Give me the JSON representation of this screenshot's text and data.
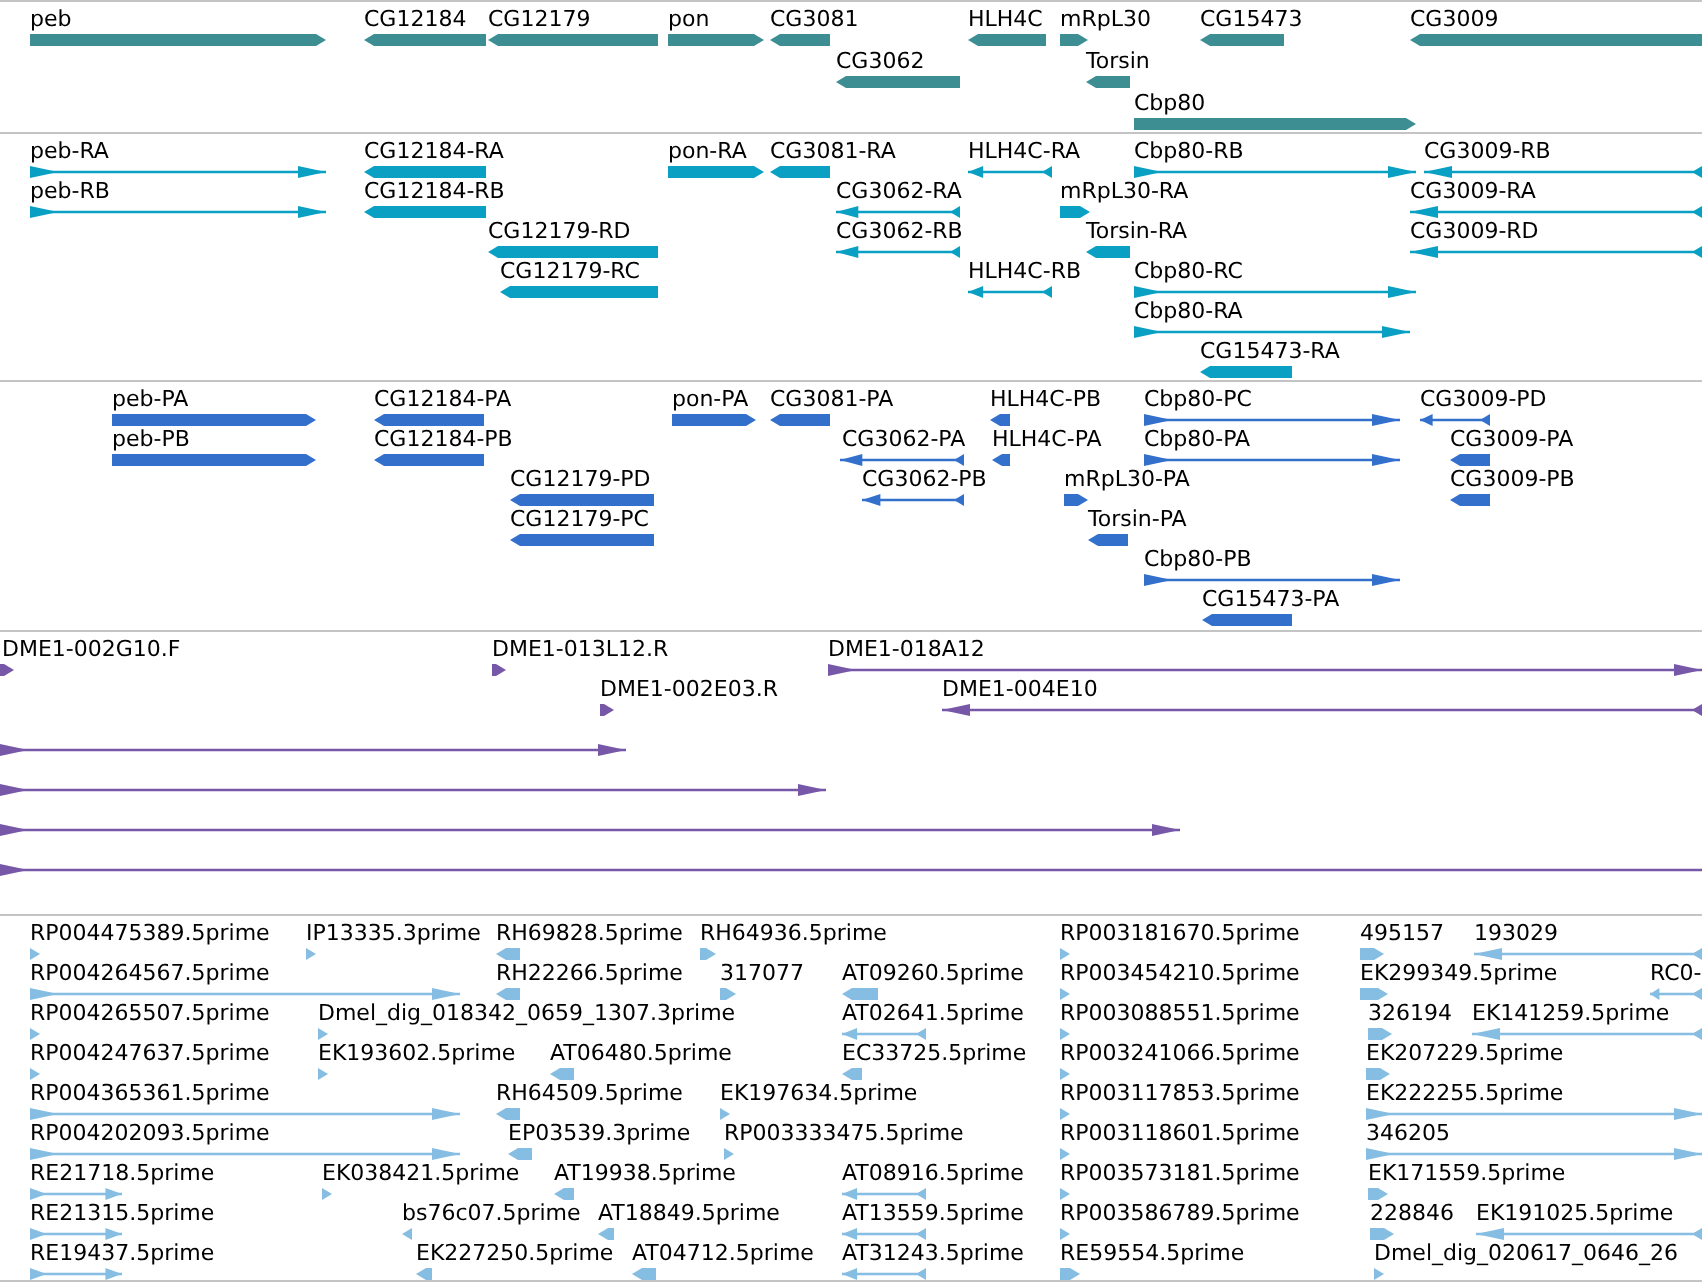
{
  "tracks": [
    {
      "kind": "gene",
      "rows": [
        {
          "features": [
            {
              "label": "peb",
              "forward": true,
              "kind": "block"
            },
            {
              "label": "CG12184",
              "forward": false,
              "kind": "block"
            },
            {
              "label": "CG12179",
              "forward": false,
              "kind": "block"
            },
            {
              "label": "pon",
              "forward": true,
              "kind": "block"
            },
            {
              "label": "CG3081",
              "forward": false,
              "kind": "block"
            },
            {
              "label": "HLH4C",
              "forward": false,
              "kind": "block"
            },
            {
              "label": "mRpL30",
              "forward": true,
              "kind": "block"
            },
            {
              "label": "CG15473",
              "forward": false,
              "kind": "block"
            },
            {
              "label": "CG3009",
              "forward": false,
              "kind": "block"
            }
          ]
        },
        {
          "features": [
            {
              "label": "CG3062",
              "forward": false,
              "kind": "block"
            },
            {
              "label": "Torsin",
              "forward": false,
              "kind": "block"
            }
          ]
        },
        {
          "features": [
            {
              "label": "Cbp80",
              "forward": true,
              "kind": "block"
            }
          ]
        }
      ]
    },
    {
      "kind": "transcript",
      "rows": [
        {
          "features": [
            {
              "label": "peb-RA",
              "forward": true,
              "kind": "spliced"
            },
            {
              "label": "CG12184-RA",
              "forward": false,
              "kind": "block"
            },
            {
              "label": "pon-RA",
              "forward": true,
              "kind": "block"
            },
            {
              "label": "CG3081-RA",
              "forward": false,
              "kind": "block"
            },
            {
              "label": "HLH4C-RA",
              "forward": false,
              "kind": "spliced"
            },
            {
              "label": "Cbp80-RB",
              "forward": true,
              "kind": "spliced"
            },
            {
              "label": "CG3009-RB",
              "forward": false,
              "kind": "spliced"
            }
          ]
        },
        {
          "features": [
            {
              "label": "peb-RB",
              "forward": true,
              "kind": "spliced"
            },
            {
              "label": "CG12184-RB",
              "forward": false,
              "kind": "block"
            },
            {
              "label": "CG3062-RA",
              "forward": false,
              "kind": "spliced"
            },
            {
              "label": "mRpL30-RA",
              "forward": true,
              "kind": "block"
            },
            {
              "label": "CG3009-RA",
              "forward": false,
              "kind": "spliced"
            }
          ]
        },
        {
          "features": [
            {
              "label": "CG12179-RD",
              "forward": false,
              "kind": "block"
            },
            {
              "label": "CG3062-RB",
              "forward": false,
              "kind": "spliced"
            },
            {
              "label": "Torsin-RA",
              "forward": false,
              "kind": "block"
            },
            {
              "label": "CG3009-RD",
              "forward": false,
              "kind": "spliced"
            }
          ]
        },
        {
          "features": [
            {
              "label": "CG12179-RC",
              "forward": false,
              "kind": "block"
            },
            {
              "label": "HLH4C-RB",
              "forward": false,
              "kind": "spliced"
            },
            {
              "label": "Cbp80-RC",
              "forward": true,
              "kind": "spliced"
            }
          ]
        },
        {
          "features": [
            {
              "label": "Cbp80-RA",
              "forward": true,
              "kind": "spliced"
            }
          ]
        },
        {
          "features": [
            {
              "label": "CG15473-RA",
              "forward": false,
              "kind": "block"
            }
          ]
        }
      ]
    },
    {
      "kind": "protein",
      "rows": [
        {
          "features": [
            {
              "label": "peb-PA",
              "forward": true,
              "kind": "block"
            },
            {
              "label": "CG12184-PA",
              "forward": false,
              "kind": "block"
            },
            {
              "label": "pon-PA",
              "forward": true,
              "kind": "block"
            },
            {
              "label": "CG3081-PA",
              "forward": false,
              "kind": "block"
            },
            {
              "label": "HLH4C-PB",
              "forward": false,
              "kind": "block"
            },
            {
              "label": "Cbp80-PC",
              "forward": true,
              "kind": "spliced"
            },
            {
              "label": "CG3009-PD",
              "forward": false,
              "kind": "spliced"
            }
          ]
        },
        {
          "features": [
            {
              "label": "peb-PB",
              "forward": true,
              "kind": "block"
            },
            {
              "label": "CG12184-PB",
              "forward": false,
              "kind": "block"
            },
            {
              "label": "CG3062-PA",
              "forward": false,
              "kind": "spliced"
            },
            {
              "label": "HLH4C-PA",
              "forward": false,
              "kind": "block"
            },
            {
              "label": "Cbp80-PA",
              "forward": true,
              "kind": "spliced"
            },
            {
              "label": "CG3009-PA",
              "forward": false,
              "kind": "block"
            }
          ]
        },
        {
          "features": [
            {
              "label": "CG12179-PD",
              "forward": false,
              "kind": "block"
            },
            {
              "label": "CG3062-PB",
              "forward": false,
              "kind": "spliced"
            },
            {
              "label": "mRpL30-PA",
              "forward": true,
              "kind": "block"
            },
            {
              "label": "CG3009-PB",
              "forward": false,
              "kind": "block"
            }
          ]
        },
        {
          "features": [
            {
              "label": "CG12179-PC",
              "forward": false,
              "kind": "block"
            },
            {
              "label": "Torsin-PA",
              "forward": false,
              "kind": "block"
            }
          ]
        },
        {
          "features": [
            {
              "label": "Cbp80-PB",
              "forward": true,
              "kind": "spliced"
            }
          ]
        },
        {
          "features": [
            {
              "label": "CG15473-PA",
              "forward": false,
              "kind": "block"
            }
          ]
        }
      ]
    },
    {
      "kind": "clone",
      "rows": [
        {
          "features": [
            {
              "label": "DME1-002G10.F",
              "forward": true,
              "kind": "block"
            },
            {
              "label": "DME1-013L12.R",
              "forward": true,
              "kind": "block"
            },
            {
              "label": "DME1-018A12",
              "forward": true,
              "kind": "spliced"
            }
          ]
        },
        {
          "features": [
            {
              "label": "DME1-002E03.R",
              "forward": true,
              "kind": "block"
            },
            {
              "label": "DME1-004E10",
              "forward": false,
              "kind": "spliced"
            }
          ]
        },
        {
          "features": [
            {
              "forward": true,
              "kind": "spliced"
            }
          ]
        },
        {
          "features": [
            {
              "forward": true,
              "kind": "spliced"
            }
          ]
        },
        {
          "features": [
            {
              "forward": true,
              "kind": "spliced"
            }
          ]
        },
        {
          "features": [
            {
              "forward": true,
              "kind": "spliced"
            }
          ]
        }
      ]
    },
    {
      "kind": "est",
      "rows": [
        {
          "features": [
            {
              "label": "RP004475389.5prime",
              "forward": true,
              "kind": "block"
            },
            {
              "label": "IP13335.3prime",
              "forward": true,
              "kind": "block"
            },
            {
              "label": "RH69828.5prime",
              "forward": false,
              "kind": "block"
            },
            {
              "label": "RH64936.5prime",
              "forward": true,
              "kind": "block"
            },
            {
              "label": "RP003181670.5prime",
              "forward": true,
              "kind": "block"
            },
            {
              "label": "495157",
              "forward": true,
              "kind": "block"
            },
            {
              "label": "193029",
              "forward": false,
              "kind": "spliced"
            }
          ]
        },
        {
          "features": [
            {
              "label": "RP004264567.5prime",
              "forward": true,
              "kind": "spliced"
            },
            {
              "label": "RH22266.5prime",
              "forward": false,
              "kind": "block"
            },
            {
              "label": "317077",
              "forward": true,
              "kind": "block"
            },
            {
              "label": "AT09260.5prime",
              "forward": false,
              "kind": "block"
            },
            {
              "label": "RP003454210.5prime",
              "forward": true,
              "kind": "block"
            },
            {
              "label": "EK299349.5prime",
              "forward": true,
              "kind": "block"
            },
            {
              "label": "RC0-",
              "forward": false,
              "kind": "spliced"
            }
          ]
        },
        {
          "features": [
            {
              "label": "RP004265507.5prime",
              "forward": true,
              "kind": "block"
            },
            {
              "label": "Dmel_dig_018342_0659_1307.3prime",
              "forward": true,
              "kind": "block"
            },
            {
              "label": "AT02641.5prime",
              "forward": false,
              "kind": "spliced"
            },
            {
              "label": "RP003088551.5prime",
              "forward": true,
              "kind": "block"
            },
            {
              "label": "326194",
              "forward": true,
              "kind": "block"
            },
            {
              "label": "EK141259.5prime",
              "forward": false,
              "kind": "spliced"
            }
          ]
        },
        {
          "features": [
            {
              "label": "RP004247637.5prime",
              "forward": true,
              "kind": "block"
            },
            {
              "label": "EK193602.5prime",
              "forward": true,
              "kind": "block"
            },
            {
              "label": "AT06480.5prime",
              "forward": false,
              "kind": "block"
            },
            {
              "label": "EC33725.5prime",
              "forward": false,
              "kind": "block"
            },
            {
              "label": "RP003241066.5prime",
              "forward": true,
              "kind": "block"
            },
            {
              "label": "EK207229.5prime",
              "forward": true,
              "kind": "block"
            }
          ]
        },
        {
          "features": [
            {
              "label": "RP004365361.5prime",
              "forward": true,
              "kind": "spliced"
            },
            {
              "label": "RH64509.5prime",
              "forward": false,
              "kind": "block"
            },
            {
              "label": "EK197634.5prime",
              "forward": true,
              "kind": "block"
            },
            {
              "label": "RP003117853.5prime",
              "forward": true,
              "kind": "block"
            },
            {
              "label": "EK222255.5prime",
              "forward": true,
              "kind": "spliced"
            }
          ]
        },
        {
          "features": [
            {
              "label": "RP004202093.5prime",
              "forward": true,
              "kind": "spliced"
            },
            {
              "label": "EP03539.3prime",
              "forward": false,
              "kind": "block"
            },
            {
              "label": "RP003333475.5prime",
              "forward": true,
              "kind": "block"
            },
            {
              "label": "RP003118601.5prime",
              "forward": true,
              "kind": "block"
            },
            {
              "label": "346205",
              "forward": true,
              "kind": "spliced"
            }
          ]
        },
        {
          "features": [
            {
              "label": "RE21718.5prime",
              "forward": true,
              "kind": "spliced"
            },
            {
              "label": "EK038421.5prime",
              "forward": true,
              "kind": "block"
            },
            {
              "label": "AT19938.5prime",
              "forward": false,
              "kind": "block"
            },
            {
              "label": "AT08916.5prime",
              "forward": false,
              "kind": "spliced"
            },
            {
              "label": "RP003573181.5prime",
              "forward": true,
              "kind": "block"
            },
            {
              "label": "EK171559.5prime",
              "forward": true,
              "kind": "block"
            }
          ]
        },
        {
          "features": [
            {
              "label": "RE21315.5prime",
              "forward": true,
              "kind": "spliced"
            },
            {
              "label": "bs76c07.5prime",
              "forward": false,
              "kind": "block"
            },
            {
              "label": "AT18849.5prime",
              "forward": false,
              "kind": "block"
            },
            {
              "label": "AT13559.5prime",
              "forward": false,
              "kind": "spliced"
            },
            {
              "label": "RP003586789.5prime",
              "forward": true,
              "kind": "block"
            },
            {
              "label": "228846",
              "forward": true,
              "kind": "block"
            },
            {
              "label": "EK191025.5prime",
              "forward": false,
              "kind": "spliced"
            }
          ]
        },
        {
          "features": [
            {
              "label": "RE19437.5prime",
              "forward": true,
              "kind": "spliced"
            },
            {
              "label": "EK227250.5prime",
              "forward": false,
              "kind": "block"
            },
            {
              "label": "AT04712.5prime",
              "forward": false,
              "kind": "block"
            },
            {
              "label": "AT31243.5prime",
              "forward": false,
              "kind": "spliced"
            },
            {
              "label": "RE59554.5prime",
              "forward": true,
              "kind": "block"
            },
            {
              "label": "Dmel_dig_020617_0646_26",
              "forward": true,
              "kind": "block"
            }
          ]
        }
      ]
    }
  ]
}
